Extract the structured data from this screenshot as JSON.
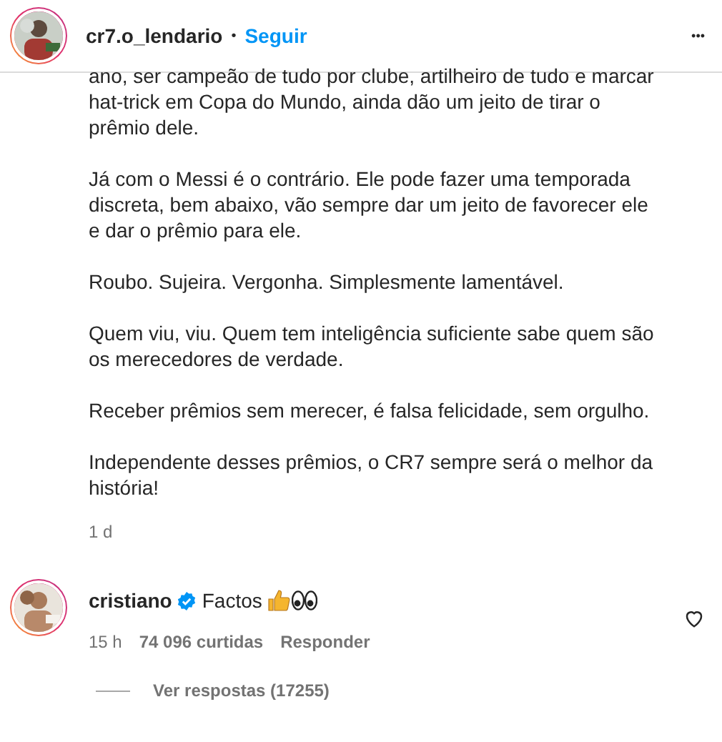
{
  "post_header": {
    "username": "cr7.o_lendario",
    "separator": "•",
    "follow": "Seguir",
    "more": "•••"
  },
  "caption": {
    "paragraphs": [
      "ano, ser campeão de tudo por clube, artilheiro de tudo e marcar hat-trick em Copa do Mundo, ainda dão um jeito de tirar o prêmio dele.",
      "Já com o Messi é o contrário. Ele pode fazer uma temporada discreta, bem abaixo, vão sempre dar um jeito de favorecer ele e dar o prêmio para ele.",
      "Roubo. Sujeira. Vergonha. Simplesmente lamentável.",
      "Quem viu, viu. Quem tem inteligência suficiente sabe quem são os merecedores de verdade.",
      "Receber prêmios sem merecer, é falsa felicidade, sem orgulho.",
      "Independente desses prêmios, o CR7 sempre será o melhor da história!"
    ],
    "time": "1 d"
  },
  "comment": {
    "username": "cristiano",
    "verified": true,
    "text": "Factos",
    "liked": false,
    "time": "15 h",
    "likes": "74 096 curtidas",
    "reply": "Responder",
    "view_replies": "Ver respostas (17255)"
  }
}
